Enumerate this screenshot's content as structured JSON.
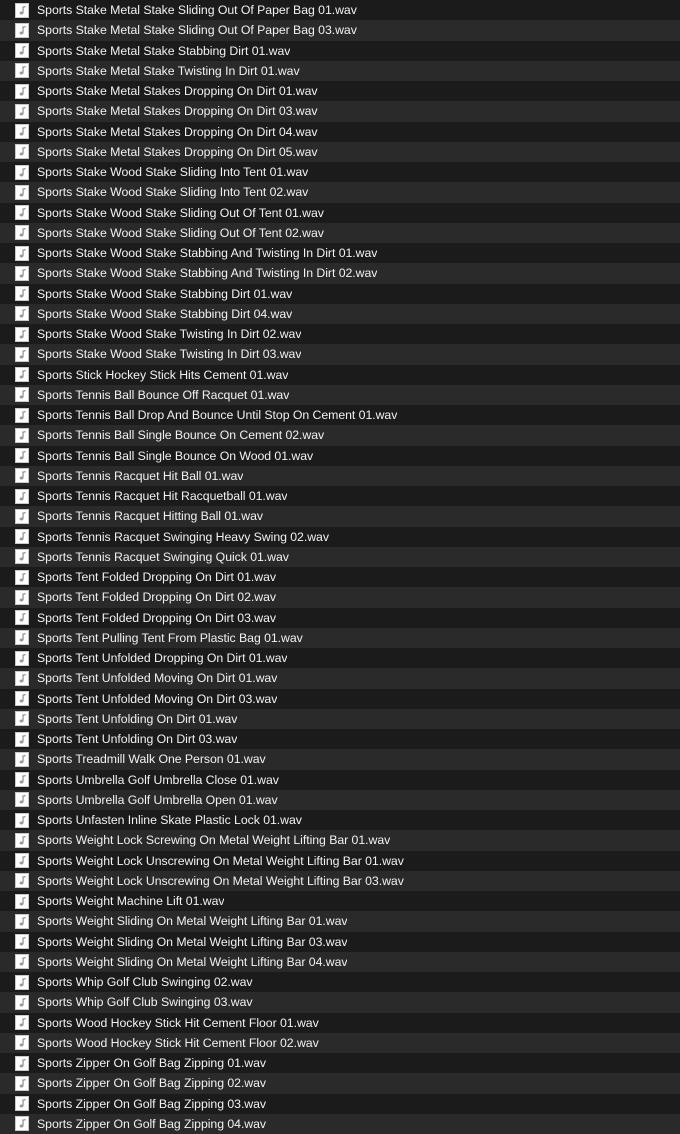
{
  "window": {
    "view_mode": "list",
    "theme": "dark",
    "background_color": "#1c1c1c",
    "row_color_odd": "#1b1b1b",
    "row_color_even": "#2a2a2a",
    "text_color": "#f2f2f2",
    "total_visible_rows": 56
  },
  "icon": {
    "name": "audio-file-icon",
    "glyph": "music-note",
    "page_color": "#ffffff",
    "note_color": "#8a8a8a"
  },
  "files": [
    {
      "name": "Sports Stake Metal Stake Sliding Out Of Paper Bag 01.wav"
    },
    {
      "name": "Sports Stake Metal Stake Sliding Out Of Paper Bag 03.wav"
    },
    {
      "name": "Sports Stake Metal Stake Stabbing Dirt 01.wav"
    },
    {
      "name": "Sports Stake Metal Stake Twisting In Dirt 01.wav"
    },
    {
      "name": "Sports Stake Metal Stakes Dropping On Dirt 01.wav"
    },
    {
      "name": "Sports Stake Metal Stakes Dropping On Dirt 03.wav"
    },
    {
      "name": "Sports Stake Metal Stakes Dropping On Dirt 04.wav"
    },
    {
      "name": "Sports Stake Metal Stakes Dropping On Dirt 05.wav"
    },
    {
      "name": "Sports Stake Wood Stake Sliding Into Tent 01.wav"
    },
    {
      "name": "Sports Stake Wood Stake Sliding Into Tent 02.wav"
    },
    {
      "name": "Sports Stake Wood Stake Sliding Out Of Tent 01.wav"
    },
    {
      "name": "Sports Stake Wood Stake Sliding Out Of Tent 02.wav"
    },
    {
      "name": "Sports Stake Wood Stake Stabbing And Twisting In Dirt 01.wav"
    },
    {
      "name": "Sports Stake Wood Stake Stabbing And Twisting In Dirt 02.wav"
    },
    {
      "name": "Sports Stake Wood Stake Stabbing Dirt 01.wav"
    },
    {
      "name": "Sports Stake Wood Stake Stabbing Dirt 04.wav"
    },
    {
      "name": "Sports Stake Wood Stake Twisting In Dirt 02.wav"
    },
    {
      "name": "Sports Stake Wood Stake Twisting In Dirt 03.wav"
    },
    {
      "name": "Sports Stick Hockey Stick Hits Cement 01.wav"
    },
    {
      "name": "Sports Tennis Ball Bounce Off Racquet 01.wav"
    },
    {
      "name": "Sports Tennis Ball Drop And Bounce Until Stop On Cement 01.wav"
    },
    {
      "name": "Sports Tennis Ball Single Bounce On Cement 02.wav"
    },
    {
      "name": "Sports Tennis Ball Single Bounce On Wood 01.wav"
    },
    {
      "name": "Sports Tennis Racquet Hit Ball 01.wav"
    },
    {
      "name": "Sports Tennis Racquet Hit Racquetball 01.wav"
    },
    {
      "name": "Sports Tennis Racquet Hitting Ball 01.wav"
    },
    {
      "name": "Sports Tennis Racquet Swinging Heavy Swing 02.wav"
    },
    {
      "name": "Sports Tennis Racquet Swinging Quick 01.wav"
    },
    {
      "name": "Sports Tent Folded Dropping On Dirt 01.wav"
    },
    {
      "name": "Sports Tent Folded Dropping On Dirt 02.wav"
    },
    {
      "name": "Sports Tent Folded Dropping On Dirt 03.wav"
    },
    {
      "name": "Sports Tent Pulling Tent From Plastic Bag 01.wav"
    },
    {
      "name": "Sports Tent Unfolded Dropping On Dirt 01.wav"
    },
    {
      "name": "Sports Tent Unfolded Moving On Dirt 01.wav"
    },
    {
      "name": "Sports Tent Unfolded Moving On Dirt 03.wav"
    },
    {
      "name": "Sports Tent Unfolding On Dirt 01.wav"
    },
    {
      "name": "Sports Tent Unfolding On Dirt 03.wav"
    },
    {
      "name": "Sports Treadmill Walk One Person 01.wav"
    },
    {
      "name": "Sports Umbrella Golf Umbrella Close 01.wav"
    },
    {
      "name": "Sports Umbrella Golf Umbrella Open 01.wav"
    },
    {
      "name": "Sports Unfasten Inline Skate Plastic Lock 01.wav"
    },
    {
      "name": "Sports Weight Lock Screwing On Metal Weight Lifting Bar 01.wav"
    },
    {
      "name": "Sports Weight Lock Unscrewing On Metal Weight Lifting Bar 01.wav"
    },
    {
      "name": "Sports Weight Lock Unscrewing On Metal Weight Lifting Bar 03.wav"
    },
    {
      "name": "Sports Weight Machine Lift 01.wav"
    },
    {
      "name": "Sports Weight Sliding On Metal Weight Lifting Bar 01.wav"
    },
    {
      "name": "Sports Weight Sliding On Metal Weight Lifting Bar 03.wav"
    },
    {
      "name": "Sports Weight Sliding On Metal Weight Lifting Bar 04.wav"
    },
    {
      "name": "Sports Whip Golf Club Swinging 02.wav"
    },
    {
      "name": "Sports Whip Golf Club Swinging 03.wav"
    },
    {
      "name": "Sports Wood Hockey Stick Hit Cement Floor 01.wav"
    },
    {
      "name": "Sports Wood Hockey Stick Hit Cement Floor 02.wav"
    },
    {
      "name": "Sports Zipper On Golf Bag Zipping 01.wav"
    },
    {
      "name": "Sports Zipper On Golf Bag Zipping 02.wav"
    },
    {
      "name": "Sports Zipper On Golf Bag Zipping 03.wav"
    },
    {
      "name": "Sports Zipper On Golf Bag Zipping 04.wav"
    }
  ]
}
